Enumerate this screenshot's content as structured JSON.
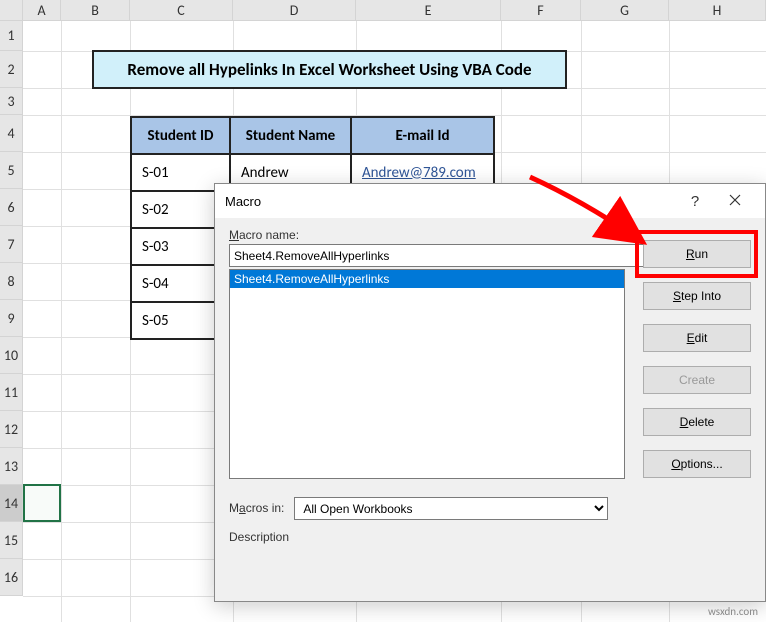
{
  "columns": [
    "A",
    "B",
    "C",
    "D",
    "E",
    "F",
    "G",
    "H"
  ],
  "rows": [
    "1",
    "2",
    "3",
    "4",
    "5",
    "6",
    "7",
    "8",
    "9",
    "10",
    "11",
    "12",
    "13",
    "14",
    "15",
    "16"
  ],
  "title": "Remove all Hypelinks In Excel Worksheet Using VBA Code",
  "table": {
    "headers": [
      "Student ID",
      "Student Name",
      "E-mail Id"
    ],
    "rows": [
      {
        "id": "S-01",
        "name": "Andrew",
        "email": "Andrew@789.com"
      },
      {
        "id": "S-02",
        "name": "",
        "email": ""
      },
      {
        "id": "S-03",
        "name": "",
        "email": ""
      },
      {
        "id": "S-04",
        "name": "",
        "email": ""
      },
      {
        "id": "S-05",
        "name": "",
        "email": ""
      }
    ]
  },
  "dialog": {
    "title": "Macro",
    "macro_name_label": "Macro name:",
    "macro_name_value": "Sheet4.RemoveAllHyperlinks",
    "list_item": "Sheet4.RemoveAllHyperlinks",
    "macros_in_label": "Macros in:",
    "macros_in_value": "All Open Workbooks",
    "description_label": "Description",
    "buttons": {
      "run": "Run",
      "step_into": "Step Into",
      "edit": "Edit",
      "create": "Create",
      "delete": "Delete",
      "options": "Options..."
    }
  },
  "watermark": "wsxdn.com"
}
